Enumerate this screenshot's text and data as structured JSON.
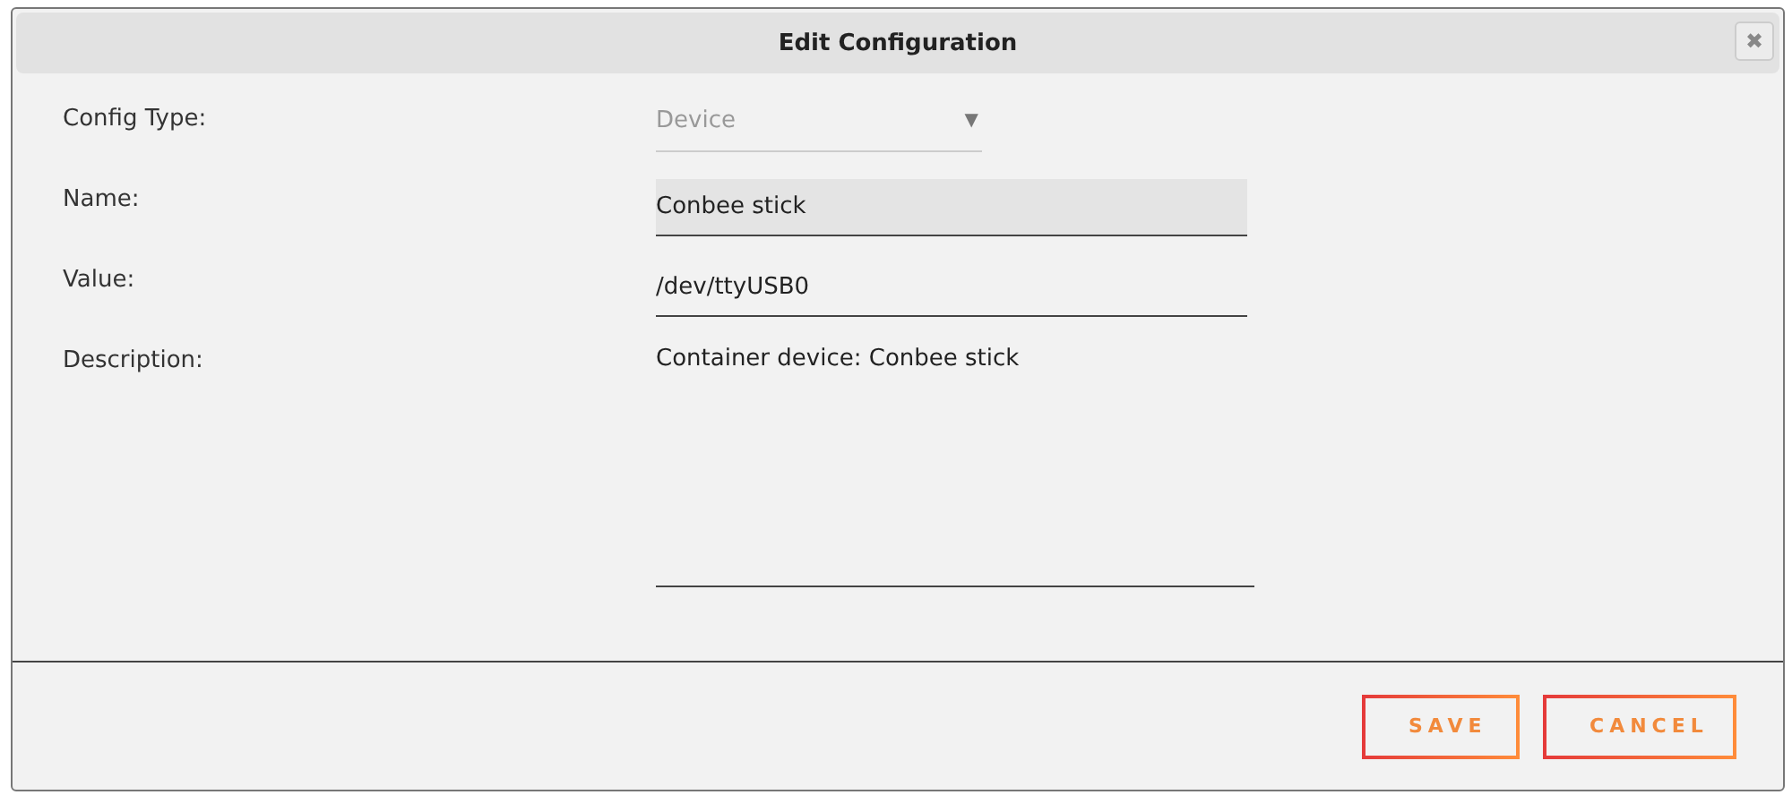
{
  "dialog": {
    "title": "Edit Configuration",
    "close_label": "✖"
  },
  "fields": [
    {
      "kind": "select",
      "label": "Config Type:",
      "value": "Device",
      "disabled": true,
      "caret": "▼"
    },
    {
      "kind": "text",
      "label": "Name:",
      "value": "Conbee stick",
      "focused": true
    },
    {
      "kind": "text",
      "label": "Value:",
      "value": "/dev/ttyUSB0",
      "focused": false
    },
    {
      "kind": "textarea",
      "label": "Description:",
      "value": "Container device: Conbee stick"
    }
  ],
  "buttons": [
    "SAVE",
    "CANCEL"
  ]
}
